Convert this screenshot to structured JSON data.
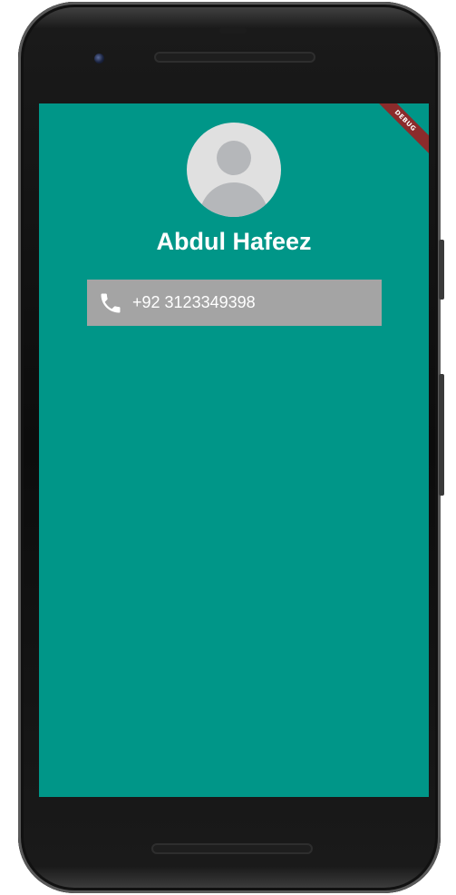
{
  "screen": {
    "background_color": "#009688",
    "debug_banner": "DEBUG"
  },
  "profile": {
    "avatar_icon": "person-placeholder-icon",
    "name": "Abdul Hafeez"
  },
  "contact": {
    "phone_icon": "phone-icon",
    "phone_number": "+92 3123349398",
    "card_color": "#a4a4a4"
  }
}
